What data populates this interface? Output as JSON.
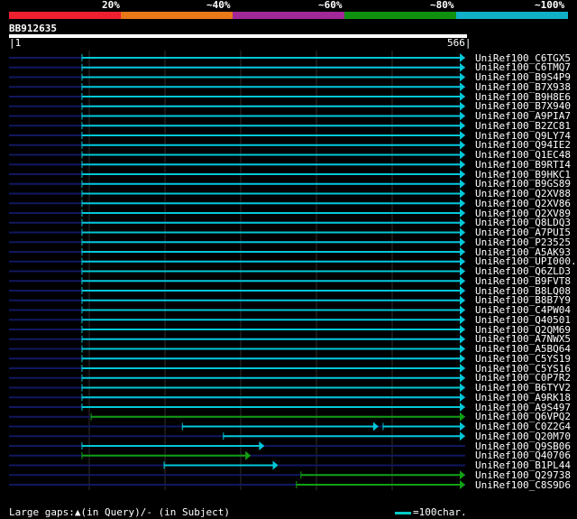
{
  "percent_scale": {
    "labels": [
      "20%",
      "~40%",
      "~60%",
      "~80%",
      "~100%"
    ],
    "colors": [
      "#ee2030",
      "#e87818",
      "#a02898",
      "#109010",
      "#10b0c8"
    ]
  },
  "query": {
    "id": "BB912635",
    "start": "1",
    "end": "566"
  },
  "colors": {
    "cyan": "#00c8d8",
    "green": "#10a010",
    "navy": "#101860",
    "grid": "#303030"
  },
  "hits": [
    {
      "label": "UniRef100_C6TGX5",
      "color": "cyan",
      "segments": [
        [
          0.16,
          1.0
        ]
      ]
    },
    {
      "label": "UniRef100_C6TMQ7",
      "color": "cyan",
      "segments": [
        [
          0.16,
          1.0
        ]
      ]
    },
    {
      "label": "UniRef100_B9S4P9",
      "color": "cyan",
      "segments": [
        [
          0.16,
          1.0
        ]
      ]
    },
    {
      "label": "UniRef100_B7X938",
      "color": "cyan",
      "segments": [
        [
          0.16,
          1.0
        ]
      ]
    },
    {
      "label": "UniRef100_B9H8E6",
      "color": "cyan",
      "segments": [
        [
          0.16,
          1.0
        ]
      ]
    },
    {
      "label": "UniRef100_B7X940",
      "color": "cyan",
      "segments": [
        [
          0.16,
          1.0
        ]
      ]
    },
    {
      "label": "UniRef100_A9PIA7",
      "color": "cyan",
      "segments": [
        [
          0.16,
          1.0
        ]
      ]
    },
    {
      "label": "UniRef100_B2ZC81",
      "color": "cyan",
      "segments": [
        [
          0.16,
          1.0
        ]
      ]
    },
    {
      "label": "UniRef100_Q9LY74",
      "color": "cyan",
      "segments": [
        [
          0.16,
          1.0
        ]
      ]
    },
    {
      "label": "UniRef100_Q94IE2",
      "color": "cyan",
      "segments": [
        [
          0.16,
          1.0
        ]
      ]
    },
    {
      "label": "UniRef100_Q1EC48",
      "color": "cyan",
      "segments": [
        [
          0.16,
          1.0
        ]
      ]
    },
    {
      "label": "UniRef100_B9RTI4",
      "color": "cyan",
      "segments": [
        [
          0.16,
          1.0
        ]
      ]
    },
    {
      "label": "UniRef100_B9HKC1",
      "color": "cyan",
      "segments": [
        [
          0.16,
          1.0
        ]
      ]
    },
    {
      "label": "UniRef100_B9GS89",
      "color": "cyan",
      "segments": [
        [
          0.16,
          1.0
        ]
      ]
    },
    {
      "label": "UniRef100_Q2XV88",
      "color": "cyan",
      "segments": [
        [
          0.16,
          1.0
        ]
      ]
    },
    {
      "label": "UniRef100_Q2XV86",
      "color": "cyan",
      "segments": [
        [
          0.16,
          1.0
        ]
      ]
    },
    {
      "label": "UniRef100_Q2XV89",
      "color": "cyan",
      "segments": [
        [
          0.16,
          1.0
        ]
      ]
    },
    {
      "label": "UniRef100_Q8LDQ3",
      "color": "cyan",
      "segments": [
        [
          0.16,
          1.0
        ]
      ]
    },
    {
      "label": "UniRef100_A7PUI5",
      "color": "cyan",
      "segments": [
        [
          0.16,
          1.0
        ]
      ]
    },
    {
      "label": "UniRef100_P23525",
      "color": "cyan",
      "segments": [
        [
          0.16,
          1.0
        ]
      ]
    },
    {
      "label": "UniRef100_A5AK93",
      "color": "cyan",
      "segments": [
        [
          0.16,
          1.0
        ]
      ]
    },
    {
      "label": "UniRef100_UPI000..",
      "color": "cyan",
      "segments": [
        [
          0.16,
          1.0
        ]
      ]
    },
    {
      "label": "UniRef100_Q6ZLD3",
      "color": "cyan",
      "segments": [
        [
          0.16,
          1.0
        ]
      ]
    },
    {
      "label": "UniRef100_B9FVT8",
      "color": "cyan",
      "segments": [
        [
          0.16,
          1.0
        ]
      ]
    },
    {
      "label": "UniRef100_B8LQ08",
      "color": "cyan",
      "segments": [
        [
          0.16,
          1.0
        ]
      ]
    },
    {
      "label": "UniRef100_B8B7Y9",
      "color": "cyan",
      "segments": [
        [
          0.16,
          1.0
        ]
      ]
    },
    {
      "label": "UniRef100_C4PW04",
      "color": "cyan",
      "segments": [
        [
          0.16,
          1.0
        ]
      ]
    },
    {
      "label": "UniRef100_Q40501",
      "color": "cyan",
      "segments": [
        [
          0.16,
          1.0
        ]
      ]
    },
    {
      "label": "UniRef100_Q2QM69",
      "color": "cyan",
      "segments": [
        [
          0.16,
          1.0
        ]
      ]
    },
    {
      "label": "UniRef100_A7NWX5",
      "color": "cyan",
      "segments": [
        [
          0.16,
          1.0
        ]
      ]
    },
    {
      "label": "UniRef100_A5BQ64",
      "color": "cyan",
      "segments": [
        [
          0.16,
          1.0
        ]
      ]
    },
    {
      "label": "UniRef100_C5YS19",
      "color": "cyan",
      "segments": [
        [
          0.16,
          1.0
        ]
      ]
    },
    {
      "label": "UniRef100_C5YS16",
      "color": "cyan",
      "segments": [
        [
          0.16,
          1.0
        ]
      ]
    },
    {
      "label": "UniRef100_C0P7R2",
      "color": "cyan",
      "segments": [
        [
          0.16,
          1.0
        ]
      ]
    },
    {
      "label": "UniRef100_B6TYV2",
      "color": "cyan",
      "segments": [
        [
          0.16,
          1.0
        ]
      ]
    },
    {
      "label": "UniRef100_A9RK18",
      "color": "cyan",
      "segments": [
        [
          0.16,
          1.0
        ]
      ]
    },
    {
      "label": "UniRef100_A9S497",
      "color": "cyan",
      "segments": [
        [
          0.16,
          1.0
        ]
      ]
    },
    {
      "label": "UniRef100_Q6VPQ2",
      "color": "green",
      "segments": [
        [
          0.18,
          1.0
        ]
      ]
    },
    {
      "label": "UniRef100_C0Z2G4",
      "color": "cyan",
      "segments": [
        [
          0.38,
          0.81
        ],
        [
          0.82,
          1.0
        ]
      ]
    },
    {
      "label": "UniRef100_Q20M70",
      "color": "cyan",
      "segments": [
        [
          0.47,
          1.0
        ]
      ]
    },
    {
      "label": "UniRef100_Q9SB06",
      "color": "cyan",
      "segments": [
        [
          0.16,
          0.56
        ]
      ]
    },
    {
      "label": "UniRef100_Q40706",
      "color": "green",
      "segments": [
        [
          0.16,
          0.53
        ]
      ]
    },
    {
      "label": "UniRef100_B1PL44",
      "color": "cyan",
      "segments": [
        [
          0.34,
          0.59
        ]
      ]
    },
    {
      "label": "UniRef100_Q29738",
      "color": "green",
      "segments": [
        [
          0.64,
          1.0
        ]
      ]
    },
    {
      "label": "UniRef100_C8S9D6",
      "color": "green",
      "segments": [
        [
          0.63,
          1.0
        ]
      ]
    }
  ],
  "footer": {
    "gaps_text": "Large gaps:▲(in Query)/- (in Subject)",
    "scale_text": "=100char."
  }
}
